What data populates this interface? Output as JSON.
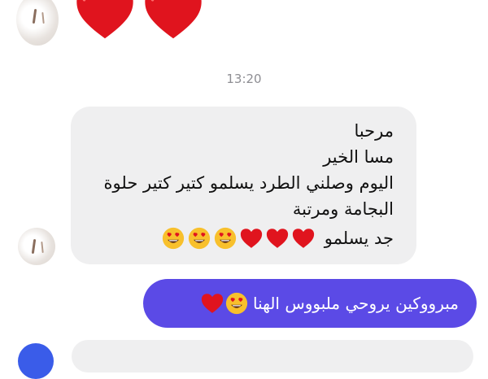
{
  "thread": {
    "timestamp": "13:20",
    "incoming": {
      "lines": [
        "مرحبا",
        "مسا الخير",
        "اليوم وصلني الطرد يسلمو كتير كتير حلوة",
        "البجامة ومرتبة"
      ],
      "last_line_text": "جد يسلمو",
      "last_line_emojis": [
        "red-heart",
        "red-heart",
        "red-heart",
        "heart-eyes",
        "heart-eyes",
        "heart-eyes"
      ]
    },
    "outgoing": {
      "text": "مبرووكين  يروحي ملبووس الهنا",
      "emojis": [
        "heart-eyes",
        "red-heart"
      ]
    }
  },
  "colors": {
    "incoming_bubble": "#efeff0",
    "outgoing_bubble": "#5b4ae6",
    "heart": "#e0141e",
    "timestamp": "#8e8e93"
  }
}
